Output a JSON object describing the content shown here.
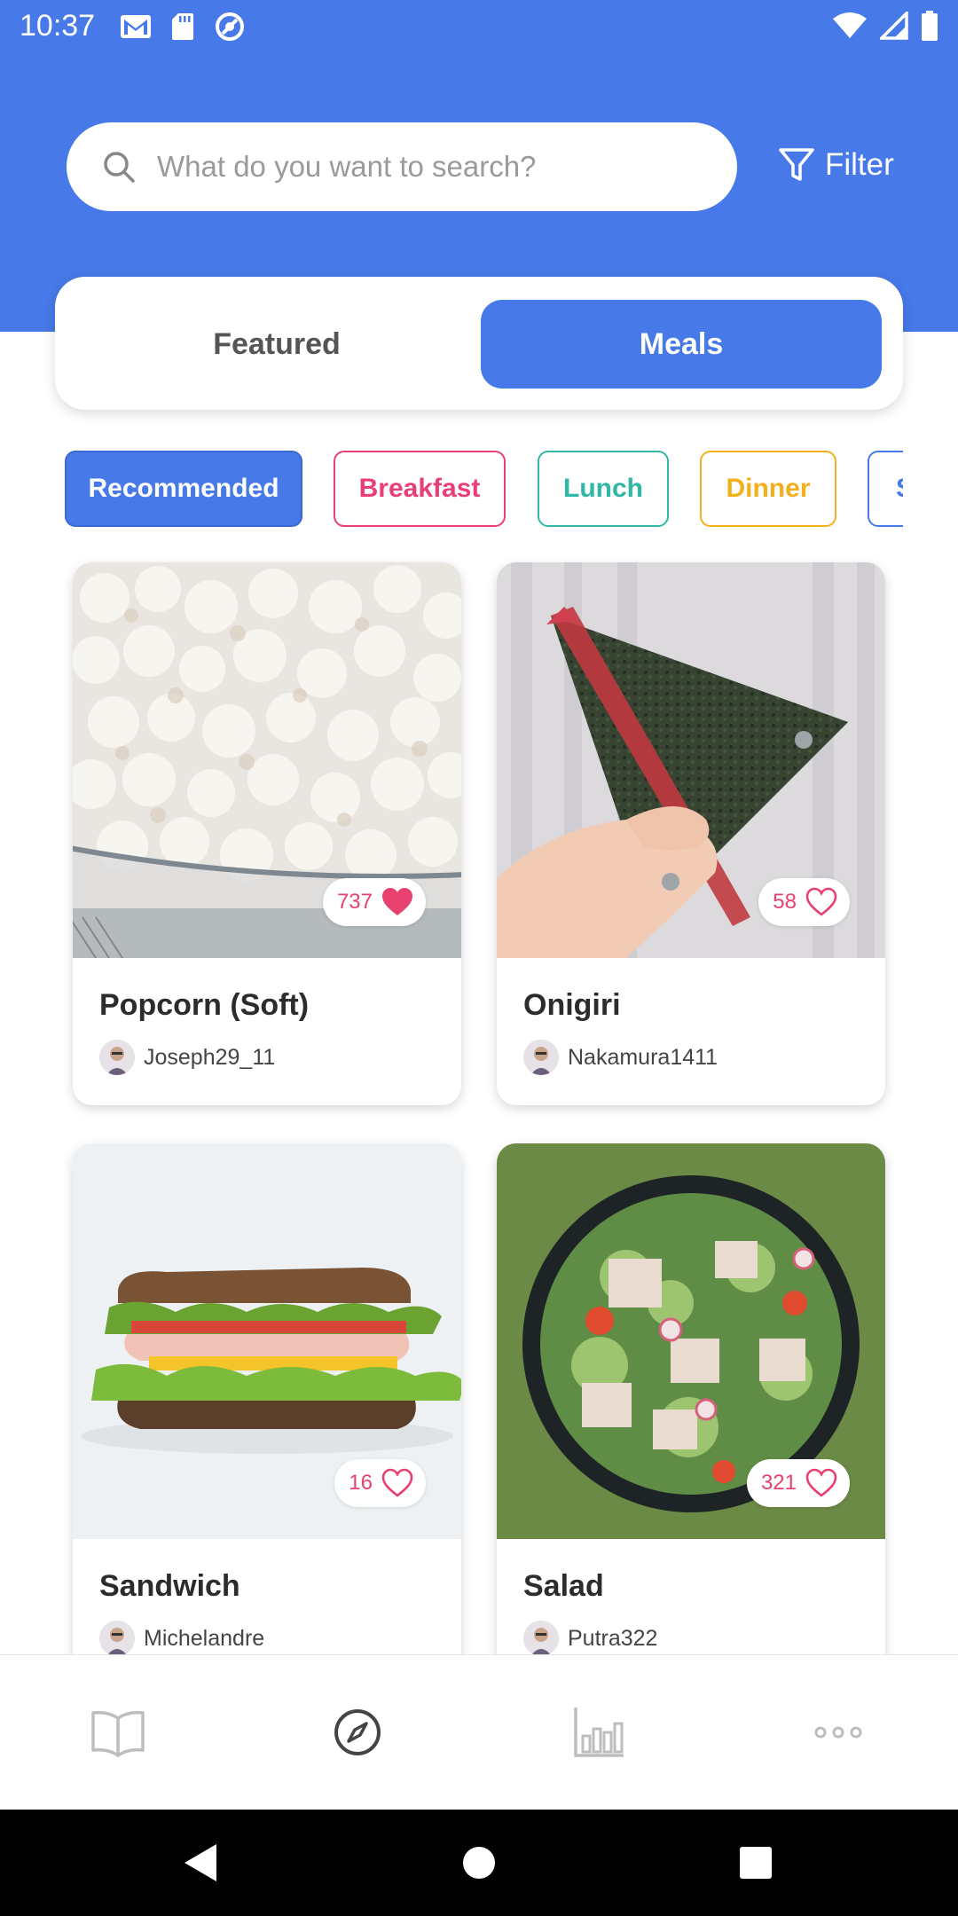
{
  "status_bar": {
    "time": "10:37",
    "icons": [
      "gmail-icon",
      "sd-card-icon",
      "sync-icon",
      "wifi-icon",
      "signal-icon",
      "battery-icon"
    ]
  },
  "search": {
    "placeholder": "What do you want to search?",
    "value": ""
  },
  "filter": {
    "label": "Filter"
  },
  "tabs": [
    {
      "label": "Featured",
      "selected": false
    },
    {
      "label": "Meals",
      "selected": true
    }
  ],
  "categories": [
    {
      "label": "Recommended",
      "selected": true,
      "color": "#4779E8"
    },
    {
      "label": "Breakfast",
      "selected": false,
      "color": "#EA3F76"
    },
    {
      "label": "Lunch",
      "selected": false,
      "color": "#2FB8A5"
    },
    {
      "label": "Dinner",
      "selected": false,
      "color": "#F2B01D"
    },
    {
      "label": "S",
      "selected": false,
      "color": "#4779E8"
    }
  ],
  "meals": [
    {
      "title": "Popcorn (Soft)",
      "author": "Joseph29_11",
      "likes": "737",
      "liked": true
    },
    {
      "title": "Onigiri",
      "author": "Nakamura1411",
      "likes": "58",
      "liked": false
    },
    {
      "title": "Sandwich",
      "author": "Michelandre",
      "likes": "16",
      "liked": false
    },
    {
      "title": "Salad",
      "author": "Putra322",
      "likes": "321",
      "liked": false
    }
  ],
  "bottom_nav": {
    "items": [
      "book-icon",
      "compass-icon",
      "bar-chart-icon",
      "more-icon"
    ],
    "active": "compass-icon"
  },
  "colors": {
    "primary": "#4779E8",
    "like": "#E8416F"
  }
}
